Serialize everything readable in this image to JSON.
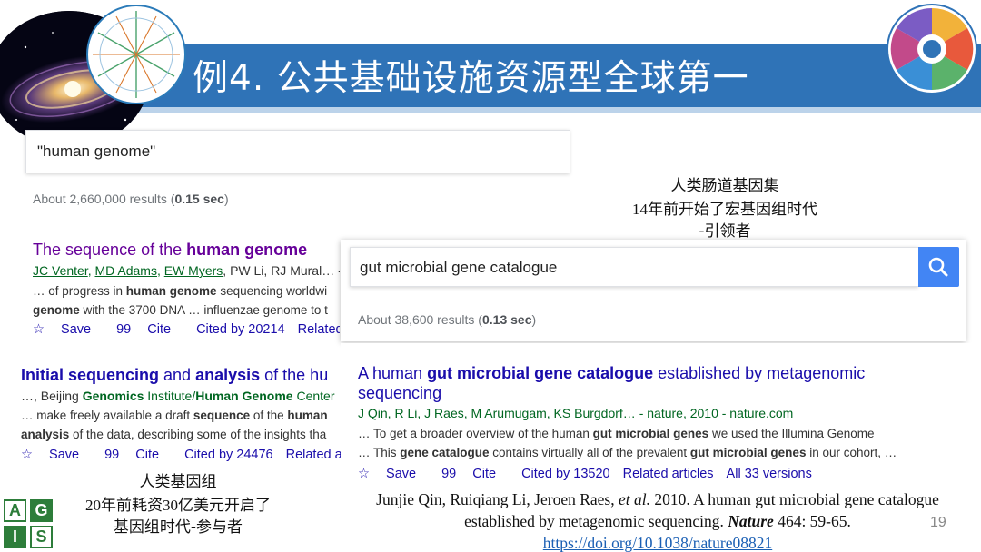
{
  "slide": {
    "title": "例4. 公共基础设施资源型全球第一",
    "page_number": "19",
    "banner_color": "#2f73b7",
    "logo_letters": [
      "A",
      "G",
      "I",
      "S"
    ]
  },
  "left_panel": {
    "query": "\"human genome\"",
    "results_prefix": "About 2,660,000 results (",
    "results_time": "0.15 sec",
    "results_suffix": ")",
    "result1": {
      "title_plain": "The sequence of the ",
      "title_bold": "human genome",
      "authors_links": [
        "JC Venter",
        "MD Adams",
        "EW Myers"
      ],
      "authors_rest": ", PW Li, RJ Mural… -",
      "snippet1_a": "… of progress in ",
      "snippet1_b": "human genome",
      "snippet1_c": " sequencing worldwi",
      "snippet2_a": "genome",
      "snippet2_b": " with the 3700 DNA … influenzae genome to t",
      "save": "Save",
      "cite": "Cite",
      "cited_by": "Cited by 20214",
      "related": "Related articles"
    },
    "result2": {
      "title_a": "Initial sequencing",
      "title_b": " and ",
      "title_c": "analysis",
      "title_d": " of the hu",
      "authors_a": "…, Beijing ",
      "authors_b": "Genomics",
      "authors_c": " Institute/",
      "authors_d": "Human Genome",
      "authors_e": " Center",
      "snippet1_a": "… make freely available a draft ",
      "snippet1_b": "sequence",
      "snippet1_c": " of the ",
      "snippet1_d": "human",
      "snippet2_a": "analysis",
      "snippet2_b": " of the data, describing some of the insights tha",
      "save": "Save",
      "cite": "Cite",
      "cited_by": "Cited by 24476",
      "related": "Related articles",
      "more": "/"
    }
  },
  "right_panel": {
    "query": "gut microbial gene catalogue",
    "results_prefix": "About 38,600 results (",
    "results_time": "0.13 sec",
    "results_suffix": ")",
    "result": {
      "title_a": "A human ",
      "title_b": "gut microbial gene catalogue",
      "title_c": " established by metagenomic",
      "title_line2": "sequencing",
      "authors_a": "J Qin, ",
      "authors_links": [
        "R Li",
        "J Raes",
        "M Arumugam"
      ],
      "authors_rest": ", KS Burgdorf… - nature, 2010 - nature.com",
      "snippet1_a": "… To get a broader overview of the human ",
      "snippet1_b": "gut microbial genes",
      "snippet1_c": " we used the Illumina Genome",
      "snippet2_a": "… This ",
      "snippet2_b": "gene catalogue",
      "snippet2_c": " contains virtually all of the prevalent ",
      "snippet2_d": "gut microbial genes",
      "snippet2_e": " in our cohort, …",
      "save": "Save",
      "cite": "Cite",
      "cited_by": "Cited by 13520",
      "related": "Related articles",
      "versions": "All 33 versions"
    }
  },
  "annotations": {
    "gut_caption": [
      "人类肠道基因集",
      "14年前开始了宏基因组时代",
      "-引领者"
    ],
    "genome_caption": [
      "人类基因组",
      "20年前耗资30亿美元开启了",
      "基因组时代-参与者"
    ]
  },
  "citation": {
    "authors": "Junjie Qin, Ruiqiang Li, Jeroen Raes, ",
    "etal": "et al.",
    "text": " 2010. A human gut microbial gene catalogue established by metagenomic sequencing. ",
    "journal": "Nature",
    "pages": " 464: 59-65. ",
    "doi": "https://doi.org/10.1038/nature08821"
  }
}
